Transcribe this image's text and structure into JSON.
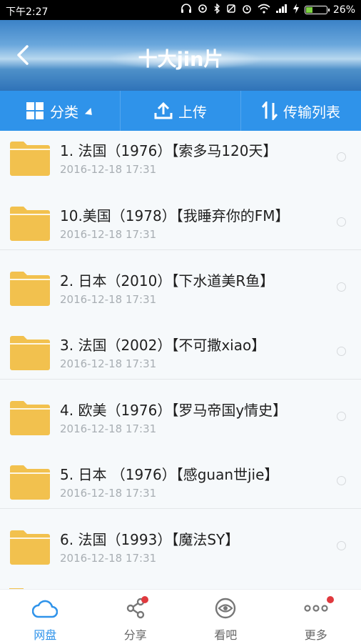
{
  "status_bar": {
    "time": "下午2:27",
    "battery": "26%"
  },
  "header": {
    "title": "十大jin片"
  },
  "toolbar": {
    "category_label": "分类",
    "upload_label": "上传",
    "transfer_label": "传输列表"
  },
  "files": [
    {
      "name": "1. 法国（1976）【索多马120天】",
      "date": "2016-12-18  17:31"
    },
    {
      "name": "10.美国（1978）【我睡弃你的FM】",
      "date": "2016-12-18  17:31"
    },
    {
      "name": "2. 日本（2010）【下水道美R鱼】",
      "date": "2016-12-18  17:31"
    },
    {
      "name": "3. 法国（2002）【不可撒xiao】",
      "date": "2016-12-18  17:31"
    },
    {
      "name": "4. 欧美（1976）【罗马帝国y情史】",
      "date": "2016-12-18  17:31"
    },
    {
      "name": "5. 日本 （1976）【感guan世jie】",
      "date": "2016-12-18  17:31"
    },
    {
      "name": "6. 法国（1993）【魔法SY】",
      "date": "2016-12-18  17:31"
    }
  ],
  "bottom_nav": {
    "items": [
      {
        "label": "网盘",
        "icon": "cloud-icon",
        "active": true
      },
      {
        "label": "分享",
        "icon": "share-icon",
        "badge": true
      },
      {
        "label": "看吧",
        "icon": "eye-icon"
      },
      {
        "label": "更多",
        "icon": "more-icon",
        "badge": true
      }
    ]
  },
  "colors": {
    "accent": "#2f93ea",
    "folder": "#f2c14e",
    "badge": "#e0393e"
  }
}
